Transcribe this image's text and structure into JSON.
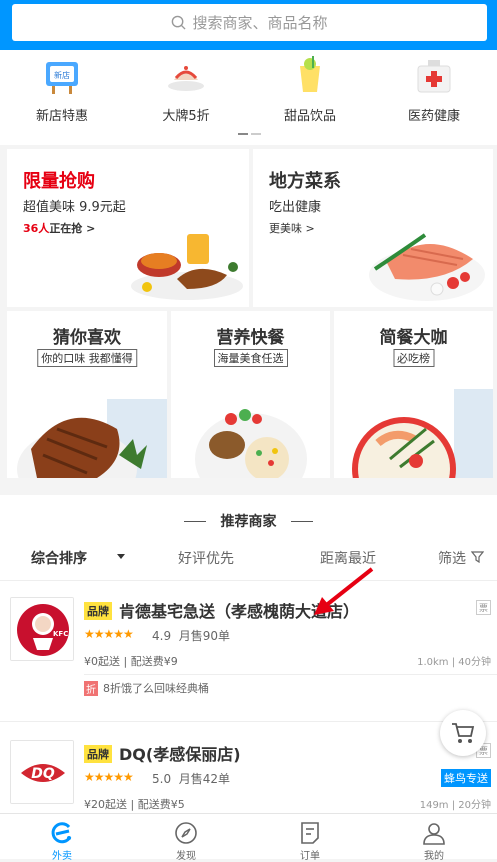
{
  "search": {
    "placeholder": "搜索商家、商品名称"
  },
  "categories": [
    {
      "label": "新店特惠",
      "icon": "new-store-sign-icon",
      "badge": "新店"
    },
    {
      "label": "大牌5折",
      "icon": "cake-plate-icon"
    },
    {
      "label": "甜品饮品",
      "icon": "lemon-drink-icon"
    },
    {
      "label": "医药健康",
      "icon": "medicine-box-icon"
    }
  ],
  "promos": {
    "flash": {
      "title": "限量抢购",
      "subtitle": "超值美味 9.9元起",
      "count": "36人",
      "count_suffix": "正在抢 >"
    },
    "local": {
      "title": "地方菜系",
      "subtitle": "吃出健康",
      "link": "更美味 >"
    },
    "guess": {
      "title": "猜你喜欢",
      "tag": "你的口味 我都懂得"
    },
    "nutrition": {
      "title": "营养快餐",
      "tag": "海量美食任选"
    },
    "coffee": {
      "title": "简餐大咖",
      "tag": "必吃榜"
    }
  },
  "recommend": {
    "title": "推荐商家",
    "sort": {
      "default": "综合排序",
      "rating": "好评优先",
      "distance": "距离最近",
      "filter": "筛选"
    }
  },
  "shops": [
    {
      "brand": "品牌",
      "name": "肯德基宅急送（孝感槐荫大道店）",
      "stars": "★★★★★",
      "rating": "4.9",
      "sales": "月售90单",
      "fee": "¥0起送 | 配送费¥9",
      "distance": "1.0km | 40分钟",
      "invoice": "票",
      "promo_badge": "折",
      "promo_text": "8折饿了么回味经典桶",
      "logo_text": "KFC"
    },
    {
      "brand": "品牌",
      "name": "DQ(孝感保丽店)",
      "stars": "★★★★★",
      "rating": "5.0",
      "sales": "月售42单",
      "fee": "¥20起送 | 配送费¥5",
      "distance": "149m | 20分钟",
      "invoice": "票",
      "delivery": "蜂鸟专送",
      "logo_text": "DQ"
    }
  ],
  "nav": [
    {
      "label": "外卖",
      "icon": "takeout-icon",
      "active": true
    },
    {
      "label": "发现",
      "icon": "compass-icon"
    },
    {
      "label": "订单",
      "icon": "order-icon"
    },
    {
      "label": "我的",
      "icon": "profile-icon"
    }
  ],
  "colors": {
    "brand_blue": "#0096ff",
    "red": "#e60012",
    "star": "#ff9900",
    "brand_tag": "#ffe23f"
  }
}
